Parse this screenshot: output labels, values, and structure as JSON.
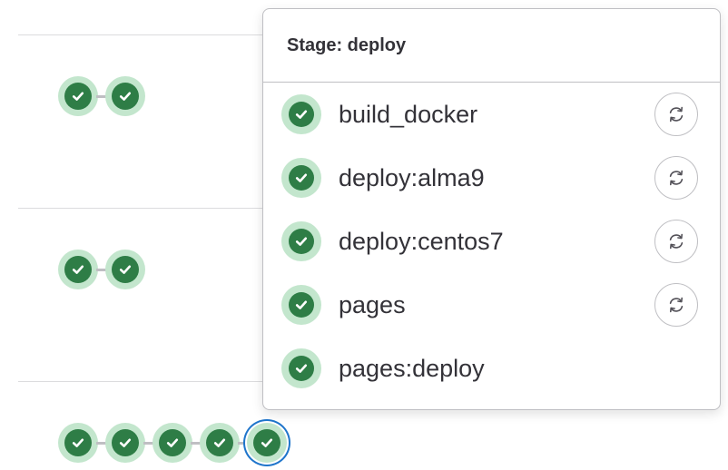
{
  "colors": {
    "success": "#2e7d46",
    "success_ring": "#c3e6cd",
    "focus": "#1f75cb",
    "border": "#bfbfc3"
  },
  "pipelines": [
    {
      "stages": [
        "success",
        "success"
      ]
    },
    {
      "stages": [
        "success",
        "success"
      ]
    },
    {
      "stages": [
        "success",
        "success",
        "success",
        "success",
        "success"
      ],
      "focused_stage": 4
    }
  ],
  "dropdown": {
    "title": "Stage: deploy",
    "jobs": [
      {
        "name": "build_docker",
        "status": "success",
        "action": "retry-icon"
      },
      {
        "name": "deploy:alma9",
        "status": "success",
        "action": "retry-icon"
      },
      {
        "name": "deploy:centos7",
        "status": "success",
        "action": "retry-icon"
      },
      {
        "name": "pages",
        "status": "success",
        "action": "retry-icon"
      },
      {
        "name": "pages:deploy",
        "status": "success",
        "action": null
      }
    ]
  }
}
